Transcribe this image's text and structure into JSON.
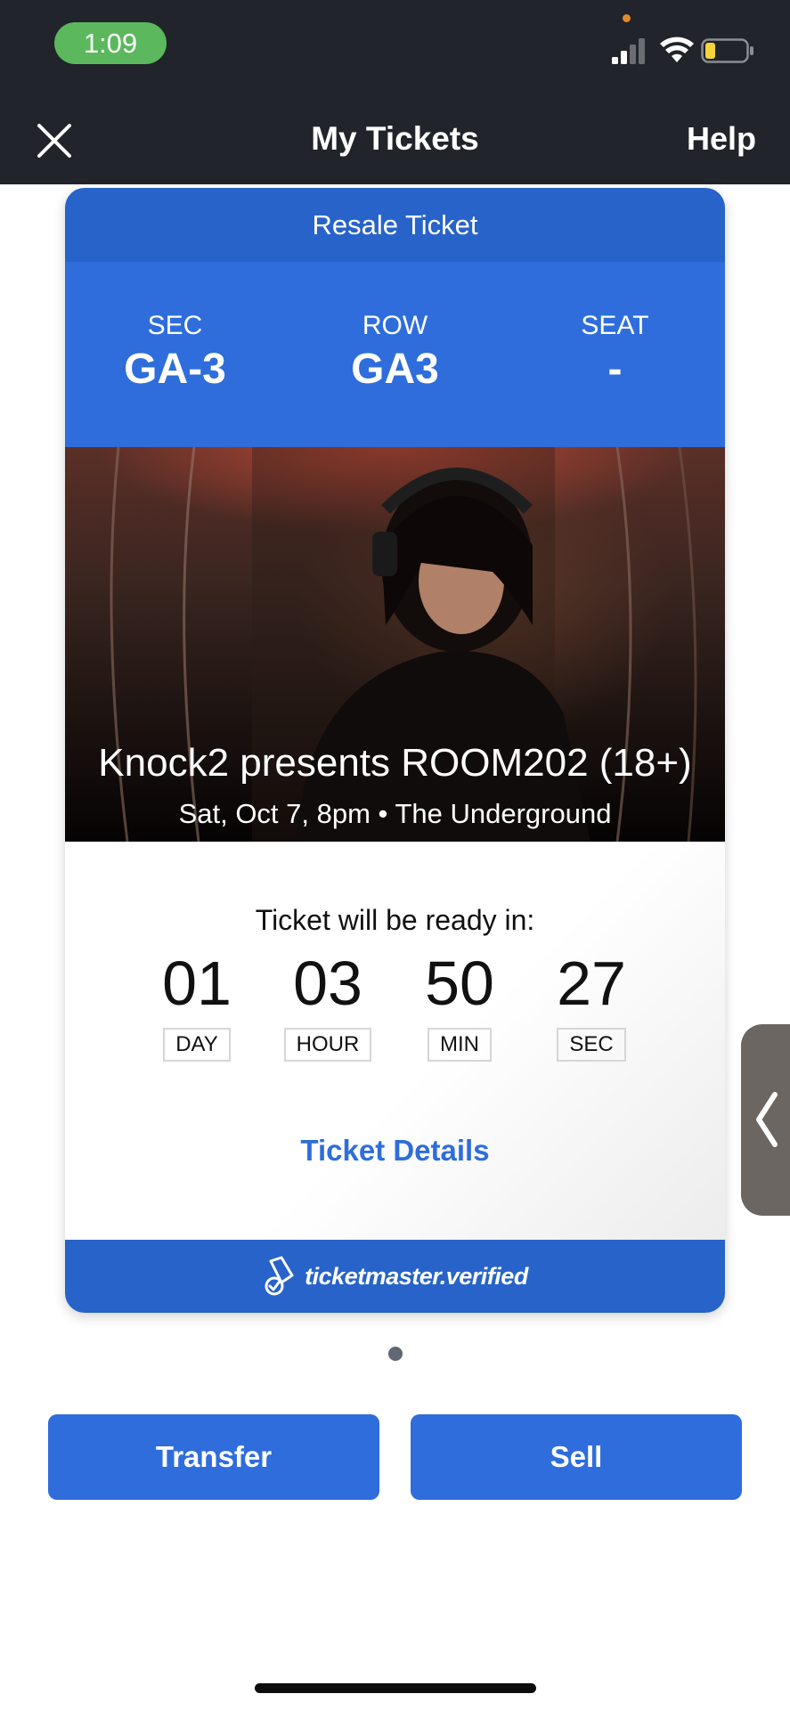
{
  "status_bar": {
    "time": "1:09",
    "signal_icon": "cellular-signal-icon",
    "wifi_icon": "wifi-icon",
    "battery_icon": "battery-low-icon"
  },
  "nav": {
    "close_icon": "close-icon",
    "title": "My Tickets",
    "help_label": "Help"
  },
  "ticket": {
    "header": "Resale Ticket",
    "sec_label": "SEC",
    "sec_value": "GA-3",
    "row_label": "ROW",
    "row_value": "GA3",
    "seat_label": "SEAT",
    "seat_value": "-",
    "event_title": "Knock2 presents ROOM202 (18+)",
    "event_meta": "Sat, Oct 7, 8pm • The Underground",
    "countdown_label": "Ticket will be ready in:",
    "countdown": [
      {
        "value": "01",
        "unit": "DAY"
      },
      {
        "value": "03",
        "unit": "HOUR"
      },
      {
        "value": "50",
        "unit": "MIN"
      },
      {
        "value": "27",
        "unit": "SEC"
      }
    ],
    "details_link": "Ticket Details",
    "verified_text": "ticketmaster.verified",
    "verified_icon": "ticket-verified-icon"
  },
  "pager": {
    "current": 1,
    "total": 1
  },
  "actions": {
    "transfer_label": "Transfer",
    "sell_label": "Sell"
  },
  "side_handle_icon": "chevron-left-icon",
  "colors": {
    "brand_blue": "#2e6ddb",
    "header_blue": "#2763c9",
    "status_bar": "#21242a",
    "time_pill": "#5bb85c"
  }
}
